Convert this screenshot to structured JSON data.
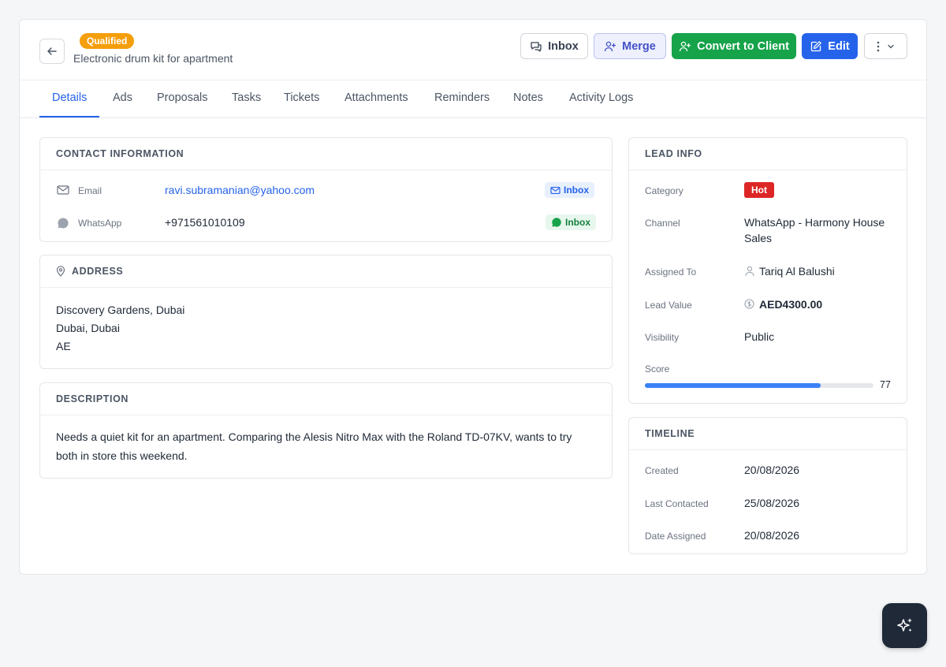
{
  "header": {
    "status_badge": "Qualified",
    "subtitle": "Electronic drum kit for apartment",
    "buttons": {
      "inbox": "Inbox",
      "merge": "Merge",
      "convert": "Convert to Client",
      "edit": "Edit"
    }
  },
  "tabs": [
    "Details",
    "Ads",
    "Proposals",
    "Tasks",
    "Tickets",
    "Attachments",
    "Reminders",
    "Notes",
    "Activity Logs"
  ],
  "active_tab": "Details",
  "contact": {
    "title": "CONTACT INFORMATION",
    "email_label": "Email",
    "email_value": "ravi.subramanian@yahoo.com",
    "email_badge": "Inbox",
    "whatsapp_label": "WhatsApp",
    "whatsapp_value": "+971561010109",
    "whatsapp_badge": "Inbox"
  },
  "address": {
    "title": "ADDRESS",
    "line1": "Discovery Gardens, Dubai",
    "line2": "Dubai, Dubai",
    "line3": "AE"
  },
  "description": {
    "title": "DESCRIPTION",
    "line1": "Needs a quiet kit for an apartment. Comparing the Alesis Nitro Max with the Roland TD-07KV, wants to try",
    "line2": "both in store this weekend."
  },
  "lead_info": {
    "title": "LEAD INFO",
    "category_label": "Category",
    "category_value": "Hot",
    "channel_label": "Channel",
    "channel_line1": "WhatsApp - Harmony House",
    "channel_line2": "Sales",
    "assigned_label": "Assigned To",
    "assigned_value": "Tariq Al Balushi",
    "value_label": "Lead Value",
    "value_value": "AED4300.00",
    "visibility_label": "Visibility",
    "visibility_value": "Public",
    "score_label": "Score",
    "score_value": "77",
    "score_percent": 77
  },
  "timeline": {
    "title": "TIMELINE",
    "created_label": "Created",
    "created_value": "20/08/2026",
    "last_contacted_label": "Last Contacted",
    "last_contacted_value": "25/08/2026",
    "date_assigned_label": "Date Assigned",
    "date_assigned_value": "20/08/2026"
  },
  "colors": {
    "primary": "#2563eb",
    "success": "#16a34a",
    "warning": "#f59e0b",
    "danger": "#dc2626"
  },
  "icons": [
    "arrow-left-icon",
    "chat-icon",
    "user-plus-icon",
    "pencil-icon",
    "more-vertical-icon",
    "chevron-down-icon",
    "mail-icon",
    "whatsapp-icon",
    "map-pin-icon",
    "user-icon",
    "coin-icon",
    "sparkles-icon"
  ]
}
